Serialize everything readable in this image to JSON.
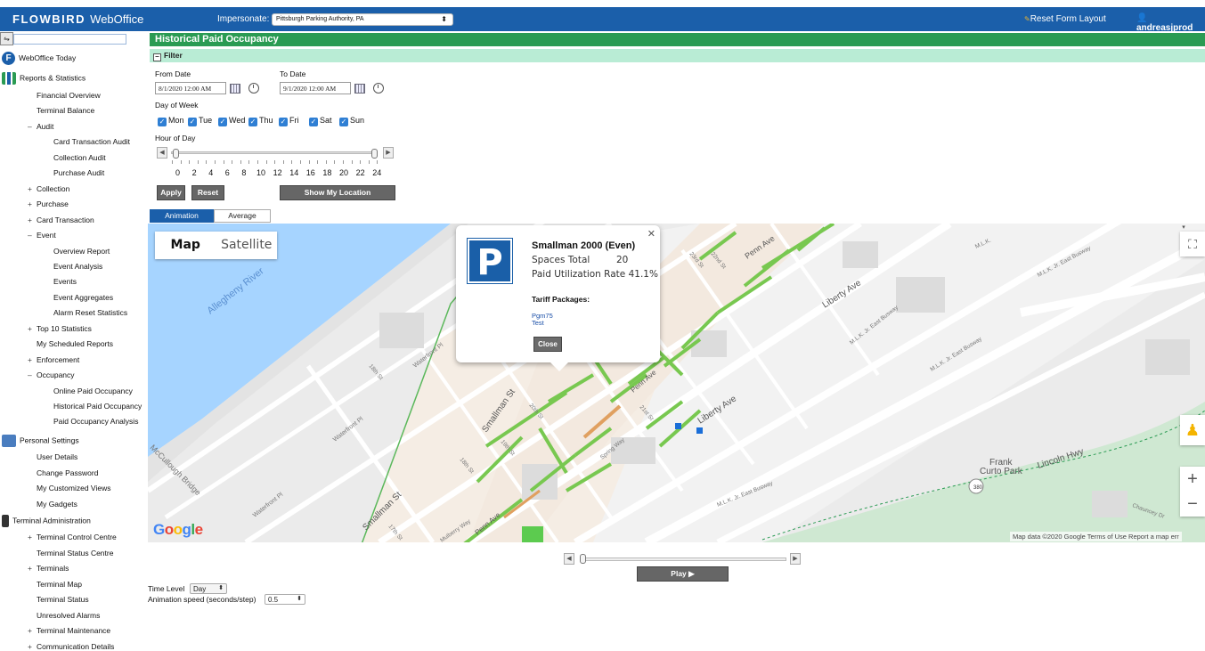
{
  "header": {
    "brand": "FLOWBIRD",
    "brand_suffix": "WebOffice",
    "impersonate_label": "Impersonate:",
    "impersonate_value": "Pittsburgh Parking Authority, PA",
    "reset_layout": "Reset Form Layout",
    "user": "andreasjprod"
  },
  "sidebar": {
    "webofficetoday": "WebOffice Today",
    "reports": "Reports & Statistics",
    "items": [
      {
        "label": "Financial Overview",
        "exp": ""
      },
      {
        "label": "Terminal Balance",
        "exp": ""
      },
      {
        "label": "Audit",
        "exp": "–"
      },
      {
        "label": "Card Transaction Audit",
        "exp": ""
      },
      {
        "label": "Collection Audit",
        "exp": ""
      },
      {
        "label": "Purchase Audit",
        "exp": ""
      },
      {
        "label": "Collection",
        "exp": "+"
      },
      {
        "label": "Purchase",
        "exp": "+"
      },
      {
        "label": "Card Transaction",
        "exp": "+"
      },
      {
        "label": "Event",
        "exp": "–"
      },
      {
        "label": "Overview Report",
        "exp": ""
      },
      {
        "label": "Event Analysis",
        "exp": ""
      },
      {
        "label": "Events",
        "exp": ""
      },
      {
        "label": "Event Aggregates",
        "exp": ""
      },
      {
        "label": "Alarm Reset Statistics",
        "exp": ""
      },
      {
        "label": "Top 10 Statistics",
        "exp": "+"
      },
      {
        "label": "My Scheduled Reports",
        "exp": ""
      },
      {
        "label": "Enforcement",
        "exp": "+"
      },
      {
        "label": "Occupancy",
        "exp": "–"
      },
      {
        "label": "Online Paid Occupancy",
        "exp": ""
      },
      {
        "label": "Historical Paid Occupancy",
        "exp": ""
      },
      {
        "label": "Paid Occupancy Analysis",
        "exp": ""
      }
    ],
    "personal": "Personal Settings",
    "personal_items": [
      {
        "label": "User Details",
        "exp": ""
      },
      {
        "label": "Change Password",
        "exp": ""
      },
      {
        "label": "My Customized Views",
        "exp": ""
      },
      {
        "label": "My Gadgets",
        "exp": ""
      }
    ],
    "terminal_admin": "Terminal Administration",
    "terminal_items": [
      {
        "label": "Terminal Control Centre",
        "exp": "+"
      },
      {
        "label": "Terminal Status Centre",
        "exp": ""
      },
      {
        "label": "Terminals",
        "exp": "+"
      },
      {
        "label": "Terminal Map",
        "exp": ""
      },
      {
        "label": "Terminal Status",
        "exp": ""
      },
      {
        "label": "Unresolved Alarms",
        "exp": ""
      },
      {
        "label": "Terminal Maintenance",
        "exp": "+"
      },
      {
        "label": "Communication Details",
        "exp": "+"
      }
    ]
  },
  "page": {
    "title": "Historical Paid Occupancy",
    "filter": "Filter",
    "from_label": "From Date",
    "from_value": "8/1/2020 12:00 AM",
    "to_label": "To Date",
    "to_value": "9/1/2020 12:00 AM",
    "dow_label": "Day of Week",
    "days": [
      "Mon",
      "Tue",
      "Wed",
      "Thu",
      "Fri",
      "Sat",
      "Sun"
    ],
    "hour_label": "Hour of Day",
    "hours": [
      "0",
      "2",
      "4",
      "6",
      "8",
      "10",
      "12",
      "14",
      "16",
      "18",
      "20",
      "22",
      "24"
    ],
    "apply": "Apply",
    "reset": "Reset",
    "show_location": "Show My Location",
    "tab_animation": "Animation",
    "tab_average": "Average"
  },
  "map": {
    "map_btn": "Map",
    "satellite_btn": "Satellite",
    "attribution": "Map data ©2020 Google   Terms of Use   Report a map err",
    "logo": [
      "G",
      "o",
      "o",
      "g",
      "l",
      "e"
    ],
    "labels": {
      "allegheny": "Allegheny River",
      "waterfront1": "Waterfront Pl",
      "waterfront2": "Waterfront Pl",
      "waterfront3": "Waterfront Pl",
      "mccullough": "McCullough Bridge",
      "smallman1": "Smallman St",
      "smallman2": "Smallman St",
      "penn1": "Penn Ave",
      "penn2": "Penn Ave",
      "penn3": "Penn Ave",
      "liberty1": "Liberty Ave",
      "liberty2": "Liberty Ave",
      "mlk1": "M.L.K. Jr. East Busway",
      "mlk2": "M.L.K. Jr. East Busway",
      "mlk3": "M.L.K. Jr. East Busway",
      "mlk4": "M.L.K. Jr. East Busway",
      "mlk5": "M.L.K.",
      "spring": "Spring Way",
      "mulberry": "Mulberry Way",
      "lincoln": "Lincoln Hwy",
      "frank": "Frank",
      "curto": "Curto Park",
      "chauncey": "Chauncey Dr",
      "route": "380",
      "s18": "18th St",
      "s17": "17th St",
      "s19": "19th St",
      "s20": "20th St",
      "s21": "21st St",
      "s22": "22nd St",
      "s23": "23rd St",
      "s18b": "18th St"
    }
  },
  "popup": {
    "title": "Smallman 2000 (Even)",
    "spaces_label": "Spaces Total",
    "spaces_value": "20",
    "util_label": "Paid Utilization Rate",
    "util_value": "41.1%",
    "tariff_label": "Tariff Packages:",
    "tariffs": [
      "Pgm75",
      "Test"
    ],
    "close": "Close",
    "icon": "P"
  },
  "bottom": {
    "play": "Play ▶",
    "time_level_label": "Time Level",
    "time_level_value": "Day",
    "speed_label": "Animation speed (seconds/step)",
    "speed_value": "0.5"
  }
}
